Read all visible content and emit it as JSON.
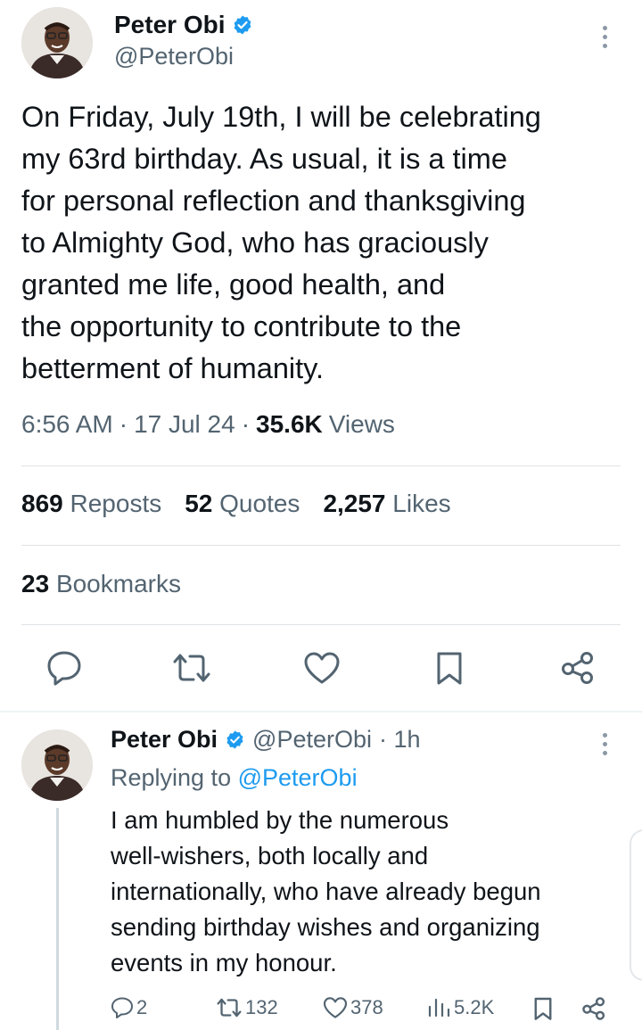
{
  "tweet": {
    "author": {
      "name": "Peter Obi",
      "handle": "@PeterObi",
      "verified_icon": "verified-badge-icon",
      "avatar": "avatar"
    },
    "text": "On Friday, July 19th, I will be celebrating\nmy 63rd birthday. As usual, it is a time\nfor personal reflection and thanksgiving\nto Almighty God, who has graciously\ngranted me life, good health, and\nthe opportunity to contribute to the\nbetterment of humanity.",
    "time": "6:56 AM",
    "separator": "·",
    "date": "17 Jul 24",
    "views_count": "35.6K",
    "views_label": "Views",
    "stats": {
      "reposts": {
        "count": "869",
        "label": "Reposts"
      },
      "quotes": {
        "count": "52",
        "label": "Quotes"
      },
      "likes": {
        "count": "2,257",
        "label": "Likes"
      },
      "bookmarks": {
        "count": "23",
        "label": "Bookmarks"
      }
    },
    "actions": [
      "reply-icon",
      "repost-icon",
      "like-icon",
      "bookmark-icon",
      "share-icon"
    ]
  },
  "reply": {
    "author": {
      "name": "Peter Obi",
      "handle": "@PeterObi",
      "time_ago": "· 1h"
    },
    "replying_prefix": "Replying to",
    "replying_to": "@PeterObi",
    "text": "I am humbled by the numerous\nwell-wishers, both locally and\ninternationally, who have already begun\nsending birthday wishes and organizing\nevents in my honour.",
    "counts": {
      "replies": "2",
      "reposts": "132",
      "likes": "378",
      "views": "5.2K"
    }
  },
  "colors": {
    "accent": "#1d9bf0",
    "text": "#0f1419",
    "muted": "#536471"
  }
}
